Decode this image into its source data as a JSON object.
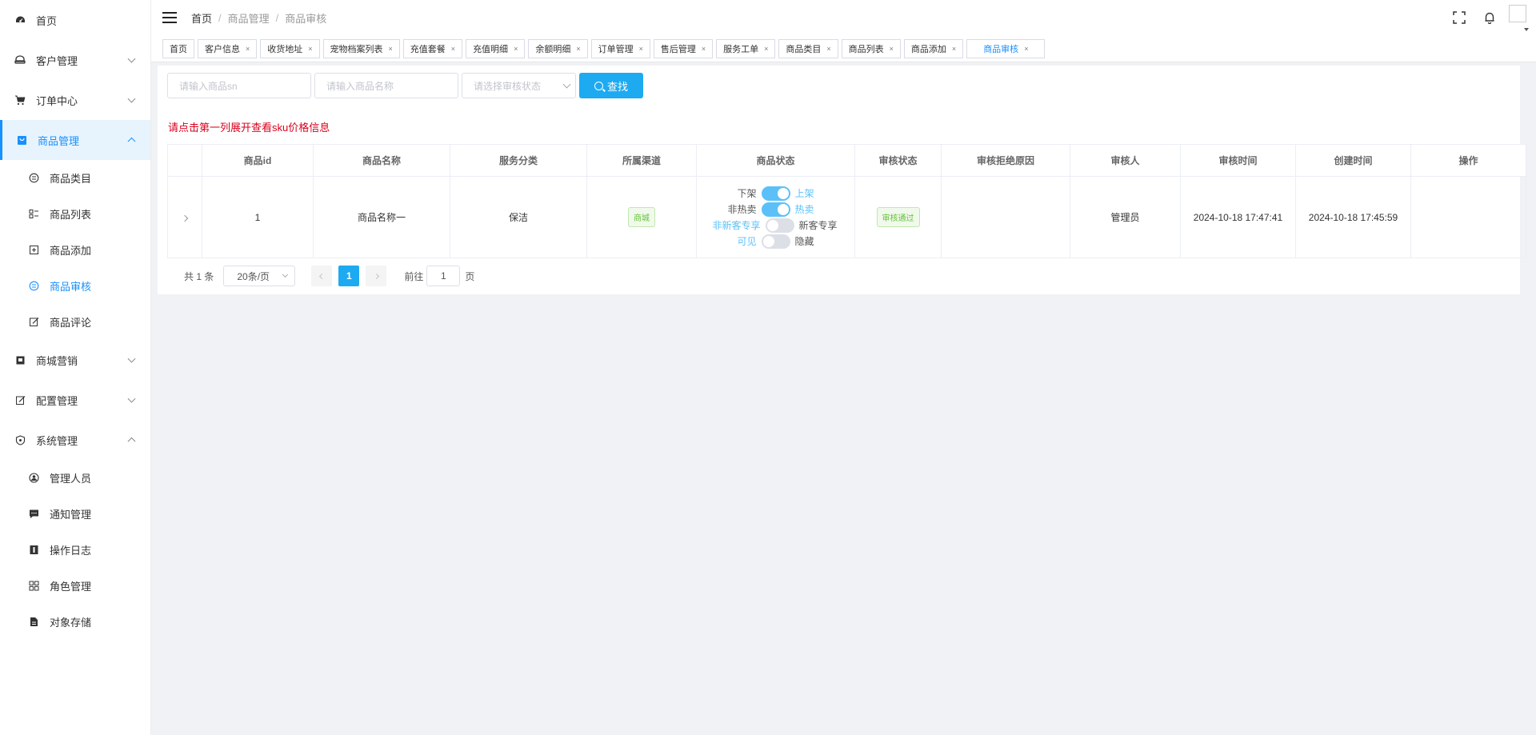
{
  "sidebar": {
    "items": [
      {
        "label": "首页"
      },
      {
        "label": "客户管理"
      },
      {
        "label": "订单中心"
      },
      {
        "label": "商品管理",
        "children": [
          {
            "label": "商品类目"
          },
          {
            "label": "商品列表"
          },
          {
            "label": "商品添加"
          },
          {
            "label": "商品审核"
          },
          {
            "label": "商品评论"
          }
        ]
      },
      {
        "label": "商城营销"
      },
      {
        "label": "配置管理"
      },
      {
        "label": "系统管理",
        "children": [
          {
            "label": "管理人员"
          },
          {
            "label": "通知管理"
          },
          {
            "label": "操作日志"
          },
          {
            "label": "角色管理"
          },
          {
            "label": "对象存储"
          }
        ]
      }
    ]
  },
  "breadcrumb": [
    "首页",
    "商品管理",
    "商品审核"
  ],
  "tags": [
    "首页",
    "客户信息",
    "收货地址",
    "宠物档案列表",
    "充值套餐",
    "充值明细",
    "余额明细",
    "订单管理",
    "售后管理",
    "服务工单",
    "商品类目",
    "商品列表",
    "商品添加",
    "商品审核"
  ],
  "search": {
    "sn_placeholder": "请输入商品sn",
    "name_placeholder": "请输入商品名称",
    "status_placeholder": "请选择审核状态",
    "button_label": "查找"
  },
  "hint": "请点击第一列展开查看sku价格信息",
  "table": {
    "headers": [
      "商品id",
      "商品名称",
      "服务分类",
      "所属渠道",
      "商品状态",
      "审核状态",
      "审核拒绝原因",
      "审核人",
      "审核时间",
      "创建时间",
      "操作"
    ],
    "rows": [
      {
        "id": "1",
        "name": "商品名称一",
        "category": "保洁",
        "channel": "商城",
        "status_switches": [
          {
            "left": "下架",
            "right": "上架",
            "on": true
          },
          {
            "left": "非热卖",
            "right": "热卖",
            "on": true
          },
          {
            "left": "非新客专享",
            "right": "新客专享",
            "on": false
          },
          {
            "left": "可见",
            "right": "隐藏",
            "on": false
          }
        ],
        "audit_status": "审核通过",
        "reject_reason": "",
        "auditor": "管理员",
        "audit_time": "2024-10-18 17:47:41",
        "created_time": "2024-10-18 17:45:59",
        "actions": ""
      }
    ]
  },
  "pager": {
    "total": "共 1 条",
    "page_size": "20条/页",
    "current": "1",
    "goto_label": "前往",
    "goto_value": "1",
    "page_unit": "页"
  },
  "colors": {
    "accent": "#1890ff",
    "button": "#1eaaf1",
    "hint": "#d9001b",
    "switch_on": "#5bc0f8",
    "tag_green": "#67c23a"
  }
}
